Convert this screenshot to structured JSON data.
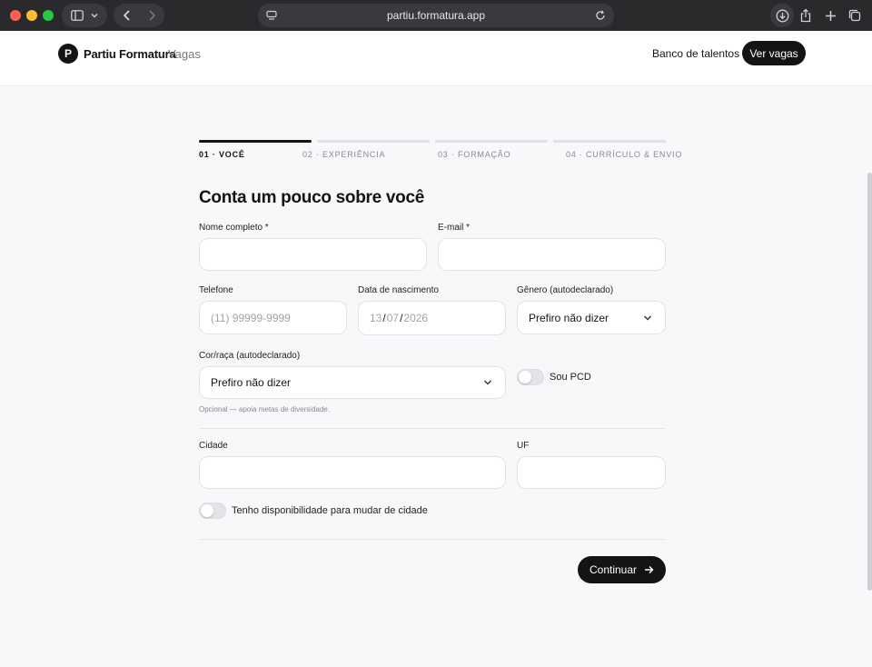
{
  "browser": {
    "url": "partiu.formatura.app"
  },
  "header": {
    "logo_letter": "P",
    "brand": "Partiu Formatura",
    "section": "· Vagas",
    "talent_link": "Banco de talentos",
    "cta": "Ver vagas"
  },
  "stepper": {
    "steps": [
      {
        "label": "01 · VOCÊ",
        "active": true
      },
      {
        "label": "02 · EXPERIÊNCIA",
        "active": false
      },
      {
        "label": "03 · FORMAÇÃO",
        "active": false
      },
      {
        "label": "04 · CURRÍCULO & ENVIO",
        "active": false
      }
    ]
  },
  "form": {
    "title": "Conta um pouco sobre você",
    "name": {
      "label": "Nome completo *",
      "value": ""
    },
    "email": {
      "label": "E-mail *",
      "value": ""
    },
    "phone": {
      "label": "Telefone",
      "placeholder": "(11) 99999-9999"
    },
    "birth": {
      "label": "Data de nascimento",
      "day": "13",
      "month": "07",
      "year": "2026"
    },
    "gender": {
      "label": "Gênero (autodeclarado)",
      "value": "Prefiro não dizer"
    },
    "race": {
      "label": "Cor/raça (autodeclarado)",
      "value": "Prefiro não dizer",
      "hint": "Opcional — apoia metas de diversidade."
    },
    "pcd": {
      "label": "Sou PCD",
      "on": false
    },
    "city": {
      "label": "Cidade",
      "value": ""
    },
    "state": {
      "label": "UF",
      "value": ""
    },
    "relocate": {
      "label": "Tenho disponibilidade para mudar de cidade",
      "on": false
    },
    "submit": "Continuar"
  },
  "colors": {
    "primary": "#141414",
    "background": "#f8f8fa",
    "border": "#e3e3e7",
    "muted": "#8a8a90"
  }
}
